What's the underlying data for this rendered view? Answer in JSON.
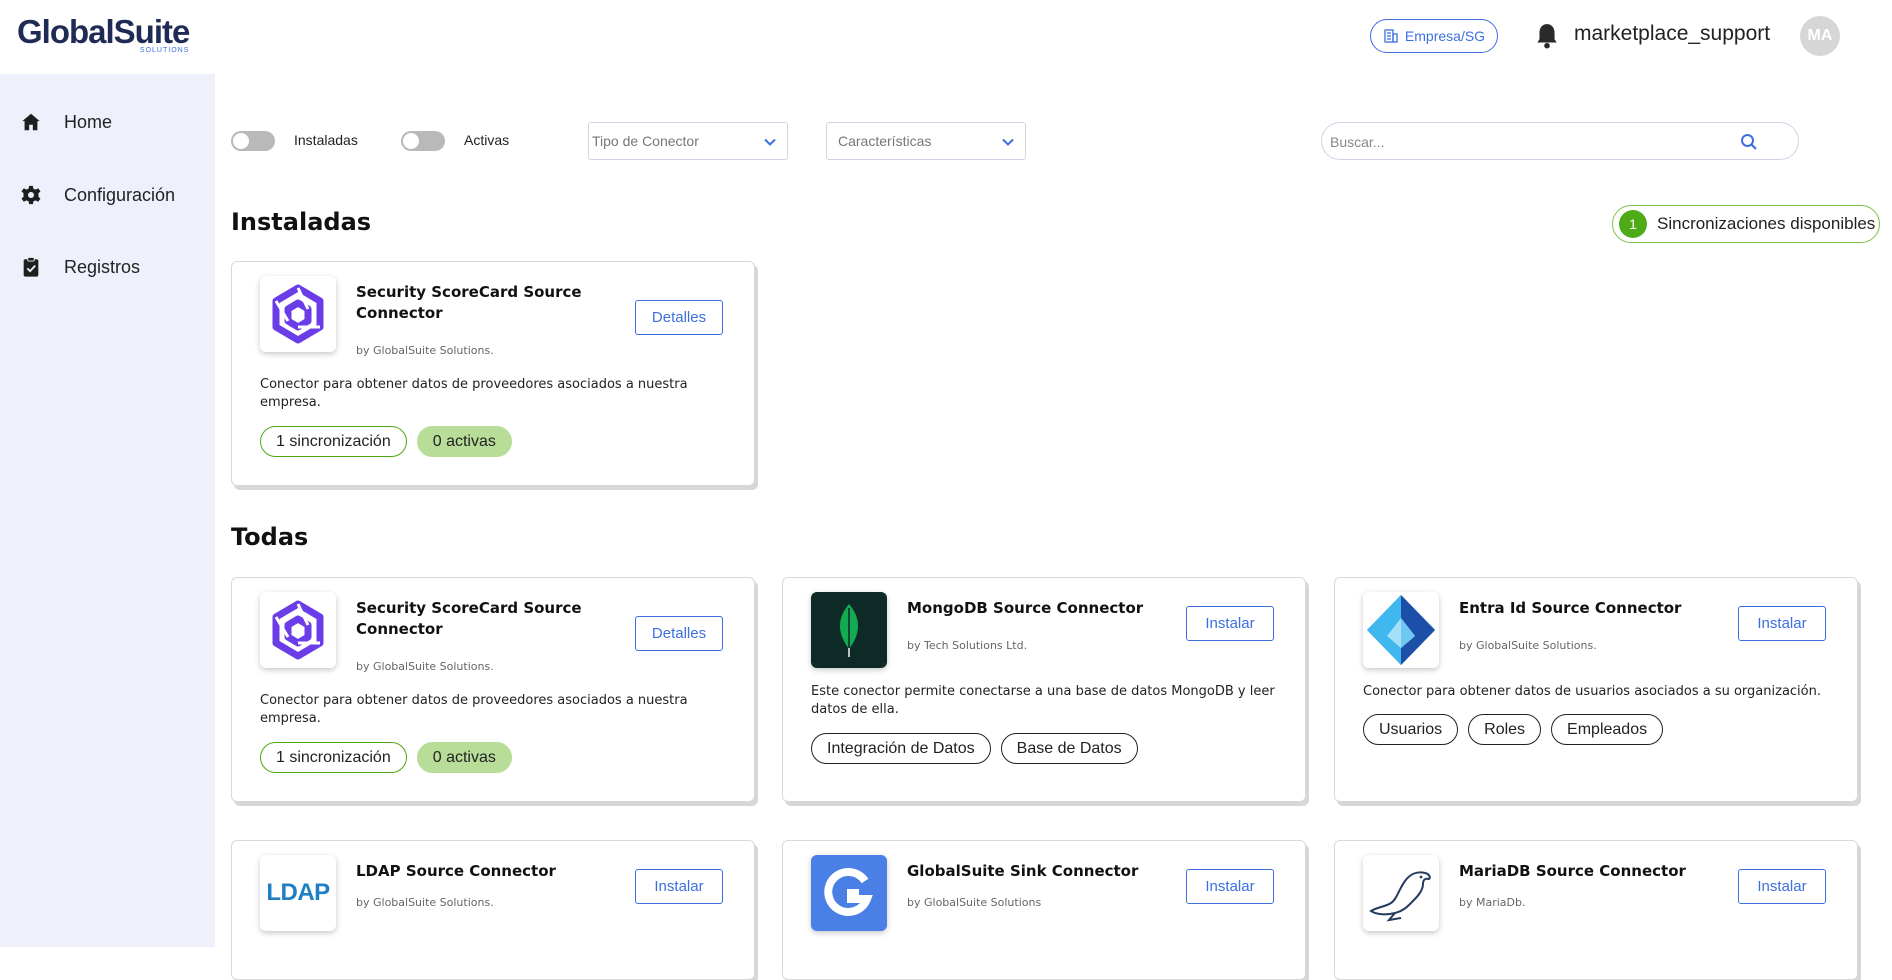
{
  "header": {
    "logo_main": "GlobalSuite",
    "logo_sub": "SOLUTIONS",
    "tenant_label": "Empresa/SG",
    "username": "marketplace_support",
    "avatar_initials": "MA"
  },
  "sidebar": {
    "items": [
      {
        "label": "Home",
        "icon": "home-icon"
      },
      {
        "label": "Configuración",
        "icon": "gear-icon"
      },
      {
        "label": "Registros",
        "icon": "clipboard-icon"
      }
    ]
  },
  "filters": {
    "installed_label": "Instaladas",
    "active_label": "Activas",
    "connector_type_placeholder": "Tipo de Conector",
    "features_placeholder": "Características",
    "search_placeholder": "Buscar..."
  },
  "installed_section": {
    "title": "Instaladas",
    "sync_badge_count": "1",
    "sync_badge_label": "Sincronizaciones disponibles",
    "cards": [
      {
        "name": "Security ScoreCard Source Connector",
        "by": "by GlobalSuite Solutions.",
        "action": "Detalles",
        "description": "Conector para obtener datos de proveedores asociados a nuestra empresa.",
        "chips": [
          "1 sincronización",
          "0 activas"
        ]
      }
    ]
  },
  "all_section": {
    "title": "Todas",
    "cards": [
      {
        "name": "Security ScoreCard Source Connector",
        "by": "by GlobalSuite Solutions.",
        "action": "Detalles",
        "description": "Conector para obtener datos de proveedores asociados a nuestra empresa.",
        "chips": [
          "1 sincronización",
          "0 activas"
        ]
      },
      {
        "name": "MongoDB Source Connector",
        "by": "by Tech Solutions Ltd.",
        "action": "Instalar",
        "description": "Este conector permite conectarse a una base de datos MongoDB y leer datos de ella.",
        "chips": [
          "Integración de Datos",
          "Base de Datos"
        ]
      },
      {
        "name": "Entra Id Source Connector",
        "by": "by GlobalSuite Solutions.",
        "action": "Instalar",
        "description": "Conector para obtener datos de usuarios asociados a su organización.",
        "chips": [
          "Usuarios",
          "Roles",
          "Empleados"
        ]
      },
      {
        "name": "LDAP Source Connector",
        "by": "by GlobalSuite Solutions.",
        "action": "Instalar",
        "logo_text": "LDAP"
      },
      {
        "name": "GlobalSuite Sink Connector",
        "by": "by GlobalSuite Solutions",
        "action": "Instalar"
      },
      {
        "name": "MariaDB Source Connector",
        "by": "by MariaDb.",
        "action": "Instalar"
      }
    ]
  },
  "colors": {
    "brand_blue": "#3d6fe0",
    "logo_navy": "#1f2b55",
    "sidebar_bg": "#eef0fb",
    "success_green": "#4eaa16",
    "chip_green_fill": "#b8dd99"
  }
}
